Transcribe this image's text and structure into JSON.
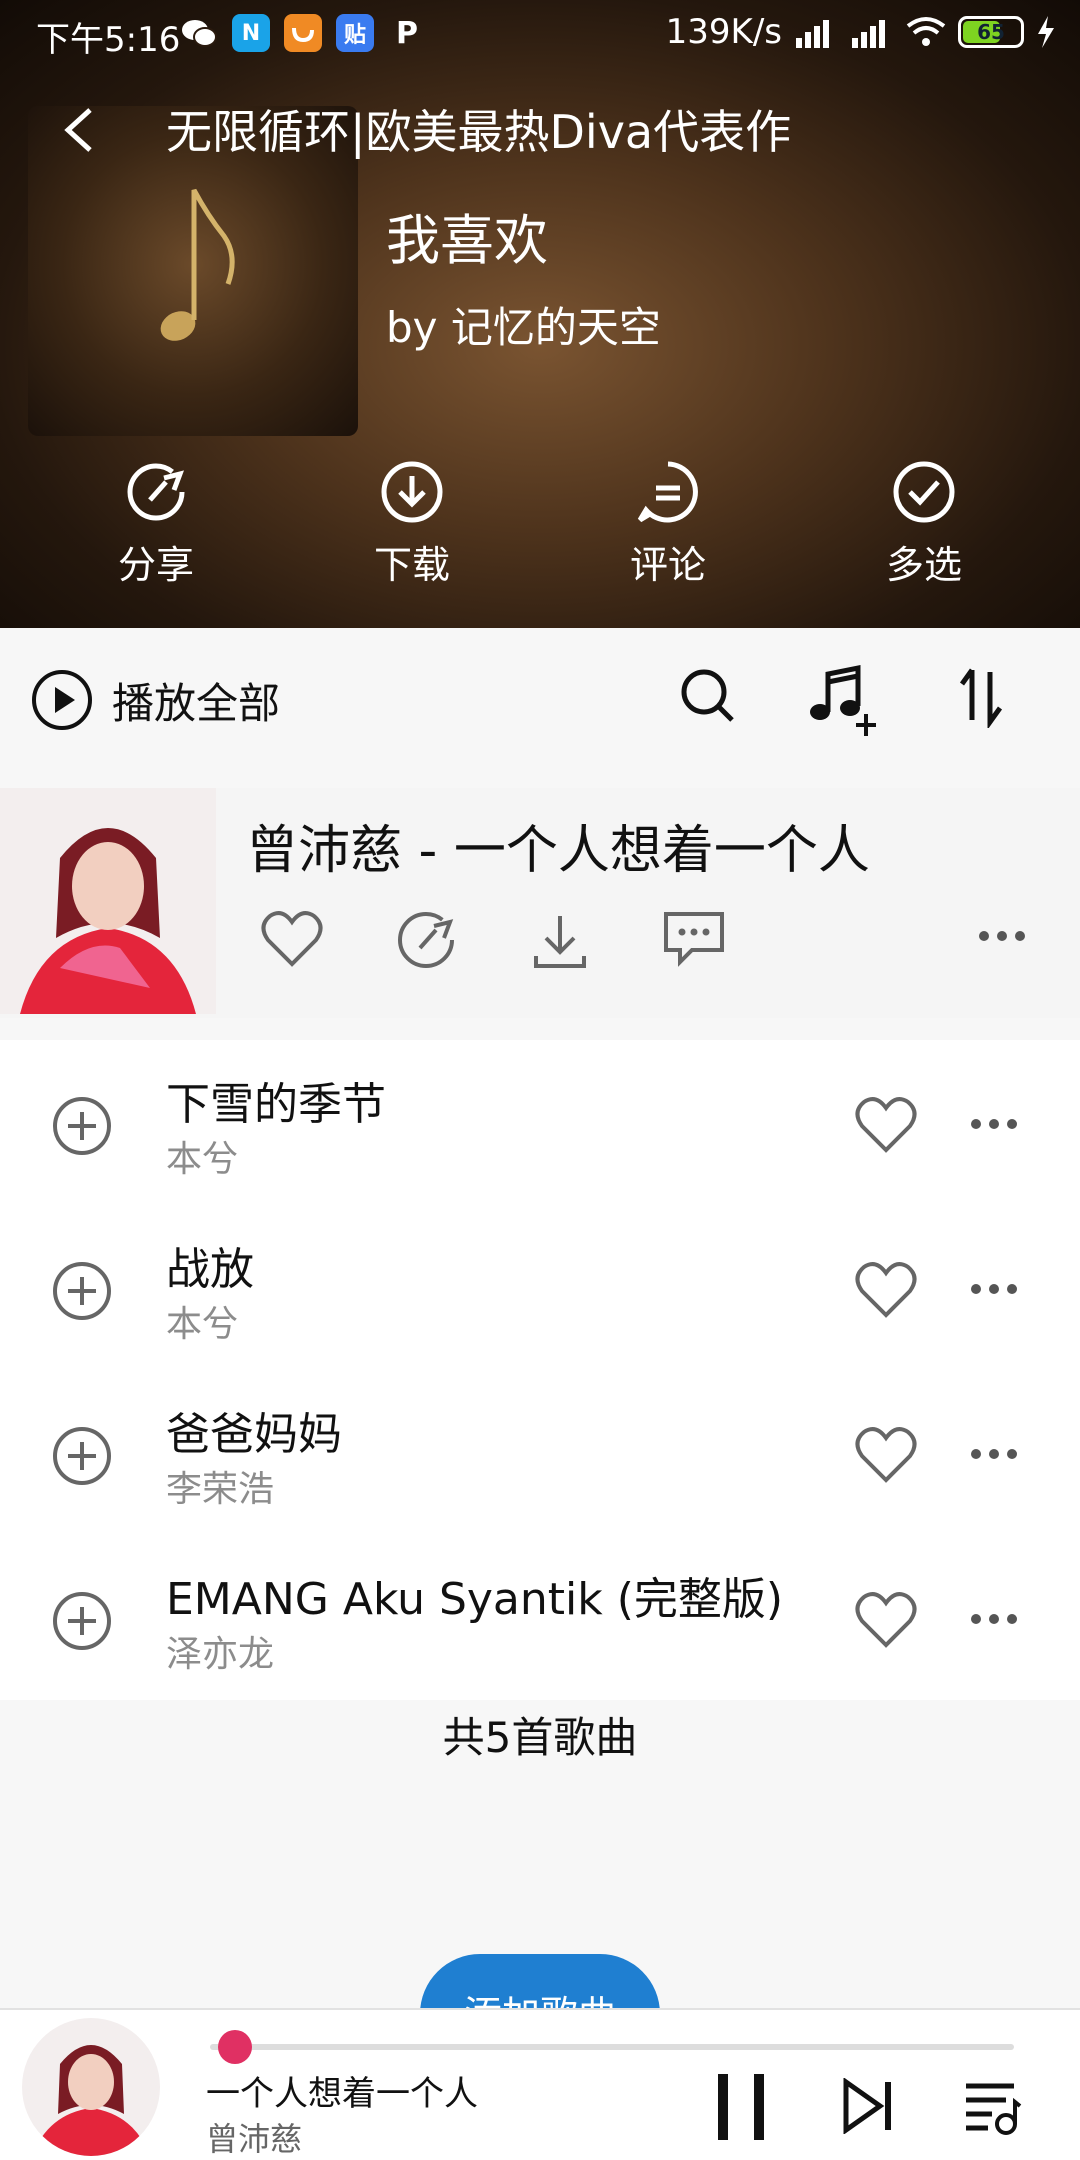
{
  "status_bar": {
    "time": "下午5:16",
    "speed": "139K/s",
    "battery": "65",
    "apps": [
      {
        "icon": "wechat-icon",
        "text": ""
      },
      {
        "icon": "n-app-icon",
        "text": "N",
        "color": "#1aa3e8"
      },
      {
        "icon": "uc-icon",
        "text": "",
        "color": "#f08a24"
      },
      {
        "icon": "tieba-icon",
        "text": "贴",
        "color": "#3a7bf0"
      },
      {
        "icon": "p-app-icon",
        "text": "P"
      }
    ]
  },
  "header": {
    "playlist_title": "无限循环|欧美最热Diva代表作",
    "name": "我喜欢",
    "creator": "by 记忆的天空"
  },
  "actions": [
    {
      "label": "分享",
      "icon": "share-icon"
    },
    {
      "label": "下载",
      "icon": "download-icon"
    },
    {
      "label": "评论",
      "icon": "comment-icon"
    },
    {
      "label": "多选",
      "icon": "multiselect-icon"
    }
  ],
  "play_all": {
    "label": "播放全部"
  },
  "current_song": {
    "title": "曾沛慈 - 一个人想着一个人"
  },
  "songs": [
    {
      "title": "下雪的季节",
      "artist": "本兮"
    },
    {
      "title": "战放",
      "artist": "本兮"
    },
    {
      "title": "爸爸妈妈",
      "artist": "李荣浩"
    },
    {
      "title": "EMANG Aku Syantik (完整版)",
      "artist": "泽亦龙"
    }
  ],
  "song_count": "共5首歌曲",
  "add_button": "添加歌曲",
  "now_playing": {
    "title": "一个人想着一个人",
    "artist": "曾沛慈",
    "progress": 0.01
  },
  "colors": {
    "accent": "#e03063",
    "button": "#1f7fd1"
  }
}
